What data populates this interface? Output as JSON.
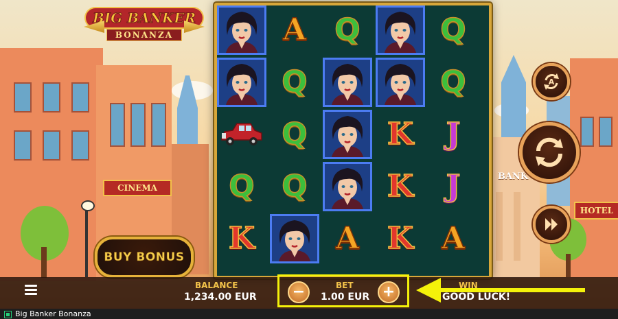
{
  "game": {
    "title_line1": "BIG BANKER",
    "title_line2": "BONANZA"
  },
  "scene": {
    "cinema_sign": "CINEMA",
    "bank_sign": "BANK",
    "hotel_sign": "HOTEL"
  },
  "reels": {
    "columns": [
      [
        {
          "symbol": "banker",
          "hl": true
        },
        {
          "symbol": "banker",
          "hl": true
        },
        {
          "symbol": "car",
          "hl": false
        },
        {
          "symbol": "Q",
          "hl": false
        },
        {
          "symbol": "K",
          "hl": false
        }
      ],
      [
        {
          "symbol": "A",
          "hl": false
        },
        {
          "symbol": "Q",
          "hl": false
        },
        {
          "symbol": "Q",
          "hl": false
        },
        {
          "symbol": "Q",
          "hl": false
        },
        {
          "symbol": "banker",
          "hl": true
        }
      ],
      [
        {
          "symbol": "Q",
          "hl": false
        },
        {
          "symbol": "banker",
          "hl": true
        },
        {
          "symbol": "banker",
          "hl": true
        },
        {
          "symbol": "banker",
          "hl": true
        },
        {
          "symbol": "A",
          "hl": false
        }
      ],
      [
        {
          "symbol": "banker",
          "hl": true
        },
        {
          "symbol": "banker",
          "hl": true
        },
        {
          "symbol": "K",
          "hl": false
        },
        {
          "symbol": "K",
          "hl": false
        },
        {
          "symbol": "K",
          "hl": false
        }
      ],
      [
        {
          "symbol": "Q",
          "hl": false
        },
        {
          "symbol": "Q",
          "hl": false
        },
        {
          "symbol": "J",
          "hl": false
        },
        {
          "symbol": "J",
          "hl": false
        },
        {
          "symbol": "A",
          "hl": false
        }
      ]
    ],
    "colors": {
      "frame": "#d8a73a",
      "bg": "#0c3a35",
      "highlight": "#1d3f86"
    }
  },
  "controls": {
    "buy_bonus_label": "BUY BONUS",
    "autoplay_icon": "autoplay-icon",
    "spin_icon": "spin-icon",
    "turbo_icon": "fast-forward-icon",
    "menu_icon": "hamburger-menu-icon"
  },
  "bottom": {
    "balance_label": "BALANCE",
    "balance_value": "1,234.00 EUR",
    "bet_label": "BET",
    "bet_value": "1.00 EUR",
    "minus": "−",
    "plus": "+",
    "win_label": "WIN",
    "win_message": "GOOD LUCK!"
  },
  "footer": {
    "tab_title": "Big Banker Bonanza"
  },
  "colors": {
    "annotation": "#f5f20a",
    "gold": "#f2c24a"
  }
}
